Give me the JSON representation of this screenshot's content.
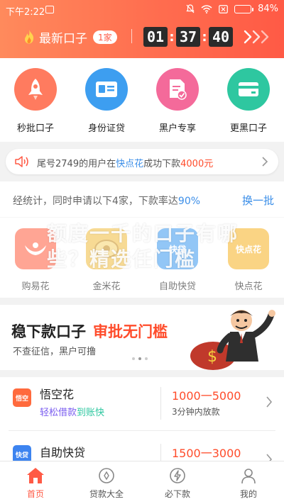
{
  "status_bar": {
    "time": "下午2:22",
    "battery": "84%"
  },
  "header": {
    "latest_label": "最新口子",
    "latest_count": "1家",
    "timer": {
      "h": "01",
      "m": "37",
      "s": "40"
    },
    "more_icon": "double-chevron-right-icon"
  },
  "menu": [
    {
      "label": "秒批口子",
      "icon": "rocket-icon",
      "color": "#ff7b5f"
    },
    {
      "label": "身份证贷",
      "icon": "id-card-icon",
      "color": "#3d9ef0"
    },
    {
      "label": "黑户专享",
      "icon": "document-check-icon",
      "color": "#f46a9a"
    },
    {
      "label": "更黑口子",
      "icon": "card-icon",
      "color": "#2ec7a0"
    }
  ],
  "notice": {
    "prefix": "尾号2749的用户在",
    "app": "快点花",
    "middle": "成功下款",
    "amount": "4000元"
  },
  "stats": {
    "text_before": "经统计，同时申请以下4家，下款率达",
    "rate": "90%",
    "refresh": "换一批"
  },
  "apps": [
    {
      "name": "购易花",
      "logo_color": "#ff6a4d"
    },
    {
      "name": "金米花",
      "logo_color": "#f2c14e"
    },
    {
      "name": "自助快贷",
      "logo_color": "#4aa0f0",
      "logo_text": "快贷"
    },
    {
      "name": "快点花",
      "logo_color": "#f7b733",
      "logo_text": "快点花"
    }
  ],
  "watermark": "额度一千的口子有哪些？精选任门槛",
  "banner": {
    "title": "稳下款口子",
    "highlight": "审批无门槛",
    "subtitle": "不查征信，黑户可撸"
  },
  "loans": [
    {
      "name": "悟空花",
      "tag_a": "轻松借款",
      "tag_b": "到账快",
      "amount": "1000一5000",
      "meta": "3分钟内放款",
      "icon_color": "#ff6a3d",
      "icon_text": "悟空"
    },
    {
      "name": "自助快贷",
      "amount": "1500一3000",
      "icon_color": "#3d84f0",
      "icon_text": "快贷"
    }
  ],
  "tabs": [
    {
      "label": "首页",
      "icon": "home-icon",
      "active": true
    },
    {
      "label": "贷款大全",
      "icon": "loan-list-icon",
      "active": false
    },
    {
      "label": "必下款",
      "icon": "lightning-icon",
      "active": false
    },
    {
      "label": "我的",
      "icon": "user-icon",
      "active": false
    }
  ]
}
